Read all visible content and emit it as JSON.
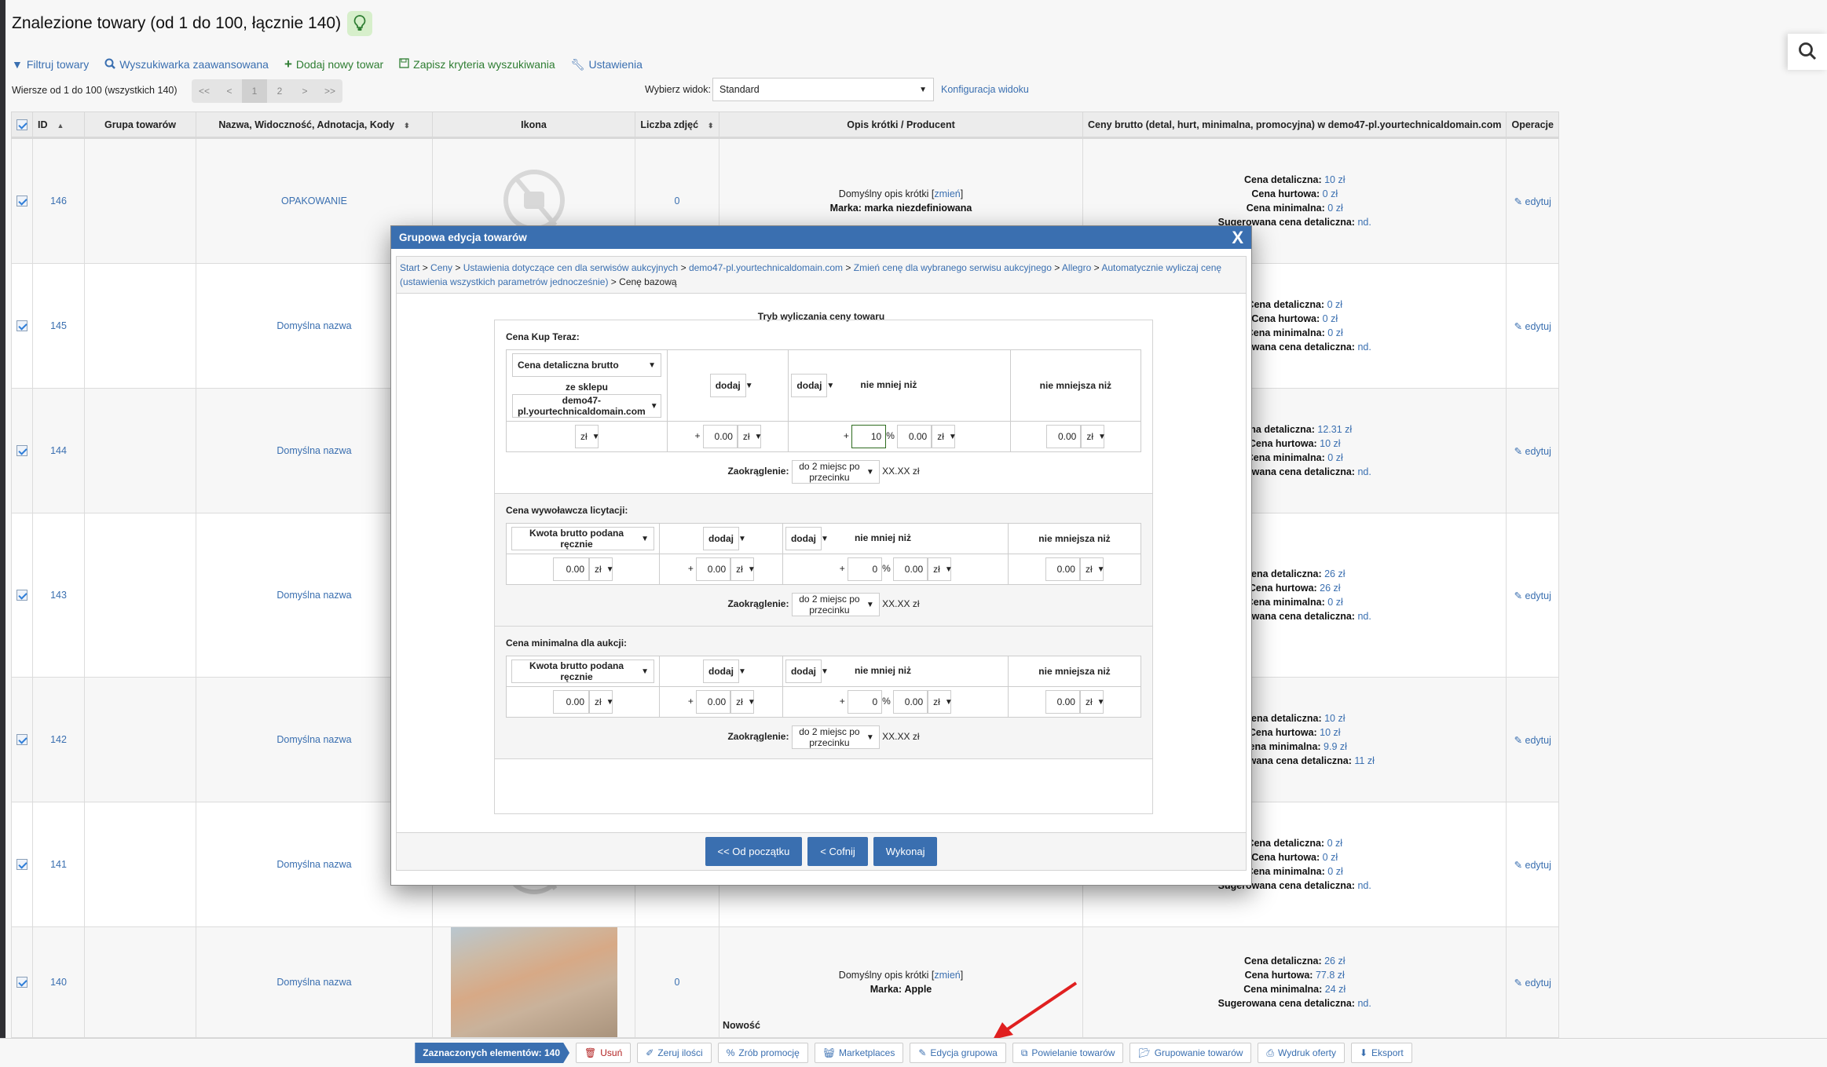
{
  "page": {
    "title": "Znalezione towary (od 1 do 100, łącznie 140)",
    "hint_icon": "lightbulb-icon"
  },
  "toolbar": {
    "filter": "Filtruj towary",
    "advanced_search": "Wyszukiwarka zaawansowana",
    "add_product": "Dodaj nowy towar",
    "save_criteria": "Zapisz kryteria wyszukiwania",
    "settings": "Ustawienia"
  },
  "pagination": {
    "rows_info": "Wiersze od 1 do 100 (wszystkich 140)",
    "first": "<<",
    "prev": "<",
    "pages": [
      "1",
      "2"
    ],
    "current": "1",
    "next": ">",
    "last": ">>"
  },
  "view": {
    "label": "Wybierz widok:",
    "selected": "Standard",
    "config_link": "Konfiguracja widoku"
  },
  "table": {
    "columns": [
      "",
      "ID",
      "Grupa towarów",
      "Nazwa, Widoczność, Adnotacja, Kody",
      "Ikona",
      "Liczba zdjęć",
      "Opis krótki / Producent",
      "Ceny brutto (detal, hurt, minimalna, promocyjna) w demo47-pl.yourtechnicaldomain.com",
      "Operacje"
    ],
    "price_labels": {
      "retail": "Cena detaliczna:",
      "wholesale": "Cena hurtowa:",
      "minimum": "Cena minimalna:",
      "suggested": "Sugerowana cena detaliczna:"
    },
    "edit_label": "edytuj",
    "rows": [
      {
        "checked": true,
        "id": "146",
        "group": "",
        "name": "OPAKOWANIE",
        "icon": "no-image",
        "photos": "0",
        "desc": "Domyślny opis krótki",
        "change": "zmień",
        "brand_label": "Marka:",
        "brand": "marka niezdefiniowana",
        "extra": "",
        "retail": "10 zł",
        "wholesale": "0 zł",
        "minimum": "0 zł",
        "suggested": "nd."
      },
      {
        "checked": true,
        "id": "145",
        "group": "",
        "name": "Domyślna nazwa",
        "icon": "no-image",
        "photos": "",
        "desc": "",
        "change": "",
        "brand_label": "",
        "brand": "",
        "extra": "",
        "retail": "0 zł",
        "wholesale": "0 zł",
        "minimum": "0 zł",
        "suggested": "nd."
      },
      {
        "checked": true,
        "id": "144",
        "group": "",
        "name": "Domyślna nazwa",
        "icon": "no-image",
        "photos": "",
        "desc": "",
        "change": "",
        "brand_label": "",
        "brand": "",
        "extra": "",
        "retail": "12.31 zł",
        "wholesale": "10 zł",
        "minimum": "0 zł",
        "suggested": "nd."
      },
      {
        "checked": true,
        "id": "143",
        "group": "",
        "name": "Domyślna nazwa",
        "icon": "no-image",
        "photos": "",
        "desc": "",
        "change": "",
        "brand_label": "",
        "brand": "",
        "extra": "",
        "retail": "26 zł",
        "wholesale": "26 zł",
        "minimum": "0 zł",
        "suggested": "nd."
      },
      {
        "checked": true,
        "id": "142",
        "group": "",
        "name": "Domyślna nazwa",
        "icon": "no-image",
        "photos": "",
        "desc": "",
        "change": "",
        "brand_label": "",
        "brand": "",
        "extra": "",
        "retail": "10 zł",
        "wholesale": "10 zł",
        "minimum": "9.9 zł",
        "suggested": "11 zł"
      },
      {
        "checked": true,
        "id": "141",
        "group": "",
        "name": "Domyślna nazwa",
        "icon": "no-image",
        "photos": "",
        "desc": "",
        "change": "",
        "brand_label": "",
        "brand": "",
        "extra": "",
        "retail": "0 zł",
        "wholesale": "0 zł",
        "minimum": "0 zł",
        "suggested": "nd."
      },
      {
        "checked": true,
        "id": "140",
        "group": "",
        "name": "Domyślna nazwa",
        "icon": "photo",
        "photos": "0",
        "desc": "Domyślny opis krótki",
        "change": "zmień",
        "brand_label": "Marka:",
        "brand": "Apple",
        "extra": "Nowość",
        "retail": "26 zł",
        "wholesale": "77.8 zł",
        "minimum": "24 zł",
        "suggested": "nd."
      }
    ]
  },
  "modal": {
    "title": "Grupowa edycja towarów",
    "close": "X",
    "breadcrumb": [
      "Start",
      "Ceny",
      "Ustawienia dotyczące cen dla serwisów aukcyjnych",
      "demo47-pl.yourtechnicaldomain.com",
      "Zmień cenę dla wybranego serwisu aukcyjnego",
      "Allegro",
      "Automatycznie wyliczaj cenę (ustawienia wszystkich parametrów jednocześnie)"
    ],
    "breadcrumb_current": "Cenę bazową",
    "separator": ">",
    "mode_title": "Tryb wyliczania ceny towaru",
    "not_less_than": "nie mniej niż",
    "not_lower_than": "nie mniejsza niż",
    "rounding_label": "Zaokrąglenie:",
    "rounding_value": "do 2 miejsc po przecinku",
    "rounding_format": "XX.XX zł",
    "sections": [
      {
        "title": "Cena Kup Teraz:",
        "source": "Cena detaliczna brutto",
        "from_shop_label": "ze sklepu",
        "shop": "demo47-pl.yourtechnicaldomain.com",
        "base_value": "",
        "base_unit": "zł",
        "op1": "dodaj",
        "add_value": "0.00",
        "add_unit": "zł",
        "op2": "dodaj",
        "percent_value": "10",
        "percent_sign": "%",
        "min_value": "0.00",
        "min_unit": "zł",
        "floor_value": "0.00",
        "floor_unit": "zł"
      },
      {
        "title": "Cena wywoławcza licytacji:",
        "source": "Kwota brutto podana ręcznie",
        "from_shop_label": "",
        "shop": "",
        "base_value": "0.00",
        "base_unit": "zł",
        "op1": "dodaj",
        "add_value": "0.00",
        "add_unit": "zł",
        "op2": "dodaj",
        "percent_value": "0",
        "percent_sign": "%",
        "min_value": "0.00",
        "min_unit": "zł",
        "floor_value": "0.00",
        "floor_unit": "zł"
      },
      {
        "title": "Cena minimalna dla aukcji:",
        "source": "Kwota brutto podana ręcznie",
        "from_shop_label": "",
        "shop": "",
        "base_value": "0.00",
        "base_unit": "zł",
        "op1": "dodaj",
        "add_value": "0.00",
        "add_unit": "zł",
        "op2": "dodaj",
        "percent_value": "0",
        "percent_sign": "%",
        "min_value": "0.00",
        "min_unit": "zł",
        "floor_value": "0.00",
        "floor_unit": "zł"
      }
    ],
    "buttons": {
      "restart": "<< Od początku",
      "back": "< Cofnij",
      "execute": "Wykonaj"
    }
  },
  "bottom_bar": {
    "selected_count": "Zaznaczonych elementów: 140",
    "actions": [
      {
        "label": "Usuń",
        "icon": "trash-icon"
      },
      {
        "label": "Zeruj ilości",
        "icon": "eraser-icon"
      },
      {
        "label": "Zrób promocję",
        "icon": "percent-icon"
      },
      {
        "label": "Marketplaces",
        "icon": "basket-icon"
      },
      {
        "label": "Edycja grupowa",
        "icon": "edit-icon"
      },
      {
        "label": "Powielanie towarów",
        "icon": "copy-icon"
      },
      {
        "label": "Grupowanie towarów",
        "icon": "folder-icon"
      },
      {
        "label": "Wydruk oferty",
        "icon": "print-icon"
      },
      {
        "label": "Eksport",
        "icon": "export-icon"
      }
    ]
  },
  "colors": {
    "accent": "#3a6fb0",
    "link": "#3a6fb0",
    "green": "#2e7d32",
    "danger": "#b22222",
    "annotation_arrow": "#e02020"
  }
}
